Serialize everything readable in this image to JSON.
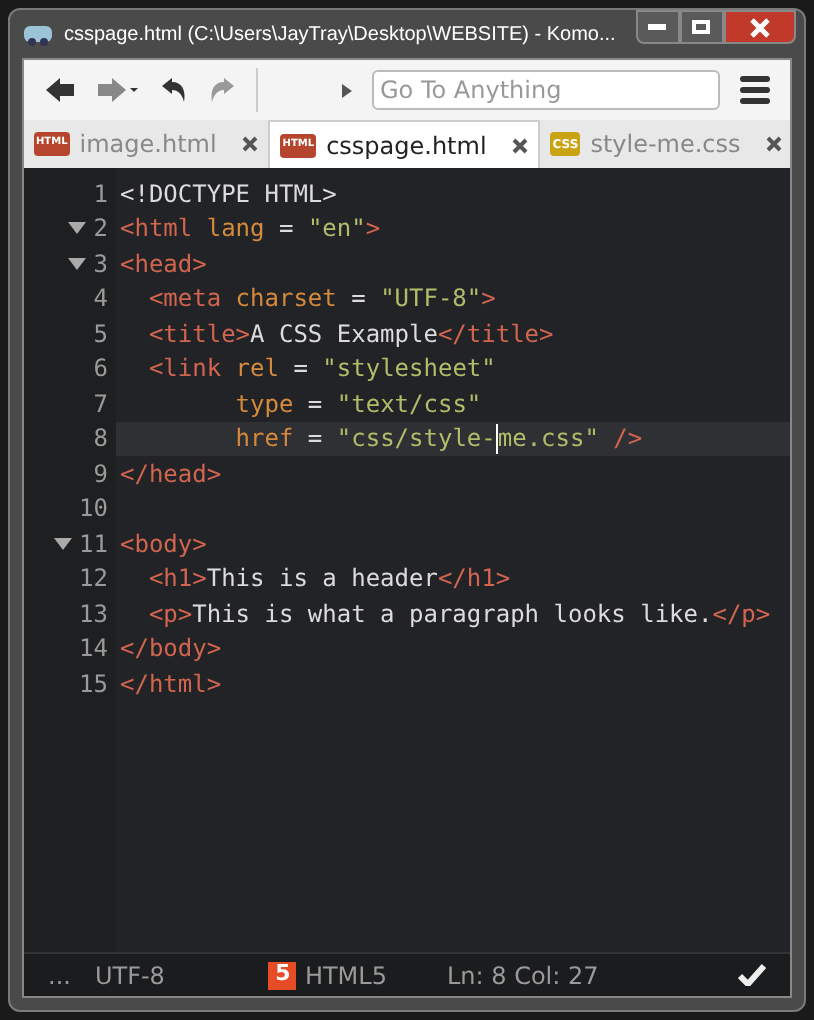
{
  "window": {
    "title": "csspage.html (C:\\Users\\JayTray\\Desktop\\WEBSITE) - Komo..."
  },
  "toolbar": {
    "search": {
      "placeholder": "Go To Anything"
    }
  },
  "tabs": [
    {
      "label": "image.html",
      "kind": "html",
      "badge": "HTML",
      "selected": false
    },
    {
      "label": "csspage.html",
      "kind": "html",
      "badge": "HTML",
      "selected": true
    },
    {
      "label": "style-me.css",
      "kind": "css",
      "badge": "CSS",
      "selected": false
    }
  ],
  "editor": {
    "lines": [
      {
        "number": "1",
        "foldable": false,
        "current": false,
        "tokens": [
          {
            "t": "<!DOCTYPE HTML>",
            "kind": "text"
          }
        ]
      },
      {
        "number": "2",
        "foldable": true,
        "current": false,
        "tokens": [
          {
            "t": "<html",
            "kind": "tag"
          },
          {
            "t": " lang",
            "kind": "attr"
          },
          {
            "t": " = ",
            "kind": "text"
          },
          {
            "t": "\"en\"",
            "kind": "string"
          },
          {
            "t": ">",
            "kind": "tag"
          }
        ]
      },
      {
        "number": "3",
        "foldable": true,
        "current": false,
        "tokens": [
          {
            "t": "<head>",
            "kind": "tag"
          }
        ]
      },
      {
        "number": "4",
        "foldable": false,
        "current": false,
        "tokens": [
          {
            "t": "  <meta",
            "kind": "tag"
          },
          {
            "t": " charset",
            "kind": "attr"
          },
          {
            "t": " = ",
            "kind": "text"
          },
          {
            "t": "\"UTF-8\"",
            "kind": "string"
          },
          {
            "t": ">",
            "kind": "tag"
          }
        ]
      },
      {
        "number": "5",
        "foldable": false,
        "current": false,
        "tokens": [
          {
            "t": "  <title>",
            "kind": "tag"
          },
          {
            "t": "A CSS Example",
            "kind": "text"
          },
          {
            "t": "</title>",
            "kind": "tag"
          }
        ]
      },
      {
        "number": "6",
        "foldable": false,
        "current": false,
        "tokens": [
          {
            "t": "  <link",
            "kind": "tag"
          },
          {
            "t": " rel",
            "kind": "attr"
          },
          {
            "t": " = ",
            "kind": "text"
          },
          {
            "t": "\"stylesheet\"",
            "kind": "string"
          }
        ]
      },
      {
        "number": "7",
        "foldable": false,
        "current": false,
        "tokens": [
          {
            "t": "        type",
            "kind": "attr"
          },
          {
            "t": " = ",
            "kind": "text"
          },
          {
            "t": "\"text/css\"",
            "kind": "string"
          }
        ]
      },
      {
        "number": "8",
        "foldable": false,
        "current": true,
        "tokens": [
          {
            "t": "        href",
            "kind": "attr"
          },
          {
            "t": " = ",
            "kind": "text"
          },
          {
            "t": "\"css/style-",
            "kind": "string"
          },
          {
            "t": "me.css\"",
            "kind": "string",
            "caret": true
          },
          {
            "t": " />",
            "kind": "tag"
          }
        ]
      },
      {
        "number": "9",
        "foldable": false,
        "current": false,
        "tokens": [
          {
            "t": "</head>",
            "kind": "tag"
          }
        ]
      },
      {
        "number": "10",
        "foldable": false,
        "current": false
      },
      {
        "number": "11",
        "foldable": true,
        "current": false,
        "tokens": [
          {
            "t": "<body>",
            "kind": "tag"
          }
        ]
      },
      {
        "number": "12",
        "foldable": false,
        "current": false,
        "tokens": [
          {
            "t": "  <h1>",
            "kind": "tag"
          },
          {
            "t": "This is a header",
            "kind": "text"
          },
          {
            "t": "</h1>",
            "kind": "tag"
          }
        ]
      },
      {
        "number": "13",
        "foldable": false,
        "current": false,
        "tokens": [
          {
            "t": "  <p>",
            "kind": "tag"
          },
          {
            "t": "This is what a paragraph looks like.",
            "kind": "text"
          },
          {
            "t": "</p>",
            "kind": "tag"
          }
        ]
      },
      {
        "number": "14",
        "foldable": false,
        "current": false,
        "tokens": [
          {
            "t": "</body>",
            "kind": "tag"
          }
        ]
      },
      {
        "number": "15",
        "foldable": false,
        "current": false,
        "tokens": [
          {
            "t": "</html>",
            "kind": "tag"
          }
        ]
      }
    ]
  },
  "status_bar": {
    "more": "...",
    "encoding": "UTF-8",
    "language_badge": "5",
    "language": "HTML5",
    "position": "Ln: 8 Col: 27"
  }
}
